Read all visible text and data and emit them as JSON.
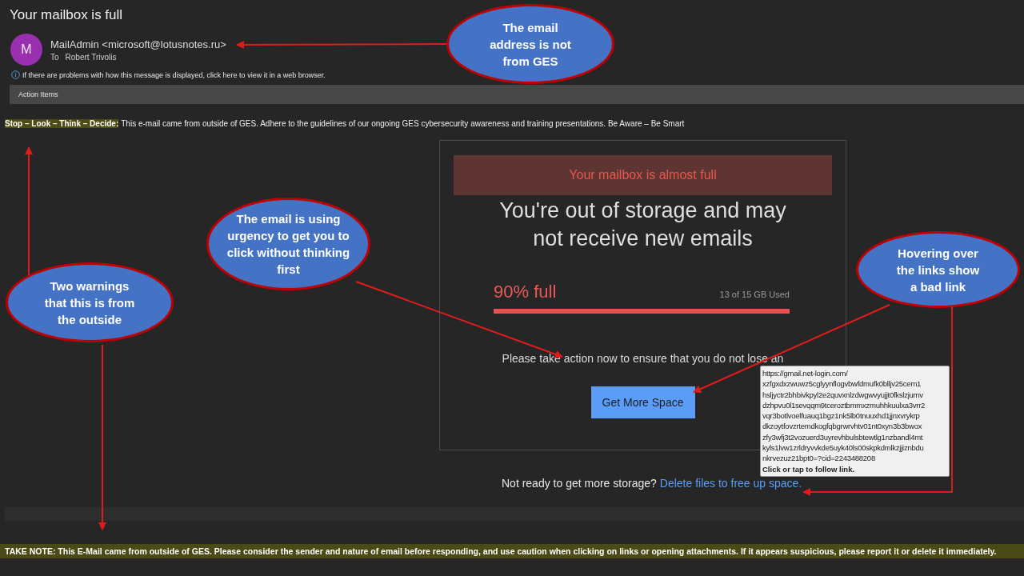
{
  "email": {
    "subject": "Your mailbox is full",
    "avatar_initial": "M",
    "sender": "MailAdmin <microsoft@lotusnotes.ru>",
    "to_label": "To",
    "recipient": "Robert Trivolis",
    "info_notice": "If there are problems with how this message is displayed, click here to view it in a web browser.",
    "action_bar": "Action Items"
  },
  "warning_banner": {
    "label": "Stop – Look – Think – Decide:",
    "text": "This e-mail came from outside of GES. Adhere to the guidelines of our ongoing GES cybersecurity awareness and training presentations. Be Aware – Be Smart"
  },
  "message": {
    "alert": "Your mailbox is almost full",
    "headline": "You're out of storage and may not receive new emails",
    "usage": {
      "percent": "90% full",
      "used": "13 of 15 GB Used"
    },
    "body": "Please take action now to ensure that you do not lose an",
    "button": "Get More Space",
    "prompt": "Not ready to get more storage?",
    "link": "Delete files to free up space."
  },
  "tooltip": {
    "url_lines": [
      "https://gmail.net-login.com/",
      "xzfgxdxzwuwz5cglyynflogvbwfdmufk0blljv25cem1",
      "hsljyctr2bhbivkpyl2e2quvxnlzdwgwvyujjt0fkslzjumv",
      "dzhpvu0l1sevqqm9tceroztbmmxzmuhhkuulxa3vrr2",
      "vqr3botlvoelfuauq1bgz1nk5lb0tnuuxhd1jjnxvrykrp",
      "dkzoytfovzrtemdkogfqbgrwrvhtv01nt0xyn3b3bwox",
      "zfy3wfj3t2vozuerd3uyrevhbulsbtewtlg1nzbandl4mt",
      "kyls1lvw1zrldryvvkde5uyk40ls00skpkdmlkzjjiznbdu",
      "nkrvezuz21bpt0=?cid=2243488208"
    ],
    "hint": "Click or tap to follow link."
  },
  "footer_notice": "TAKE NOTE: This E-Mail came from outside of GES. Please consider the sender and nature of email before responding, and use caution when clicking on links or opening attachments. If it appears suspicious, please report it or delete it immediately.",
  "callouts": [
    {
      "text": "The email address is not from GES"
    },
    {
      "text": "The email is using urgency to get you to click without thinking first"
    },
    {
      "text": "Hovering over the links show a bad link"
    },
    {
      "text": "Two warnings that this is from the outside"
    }
  ]
}
